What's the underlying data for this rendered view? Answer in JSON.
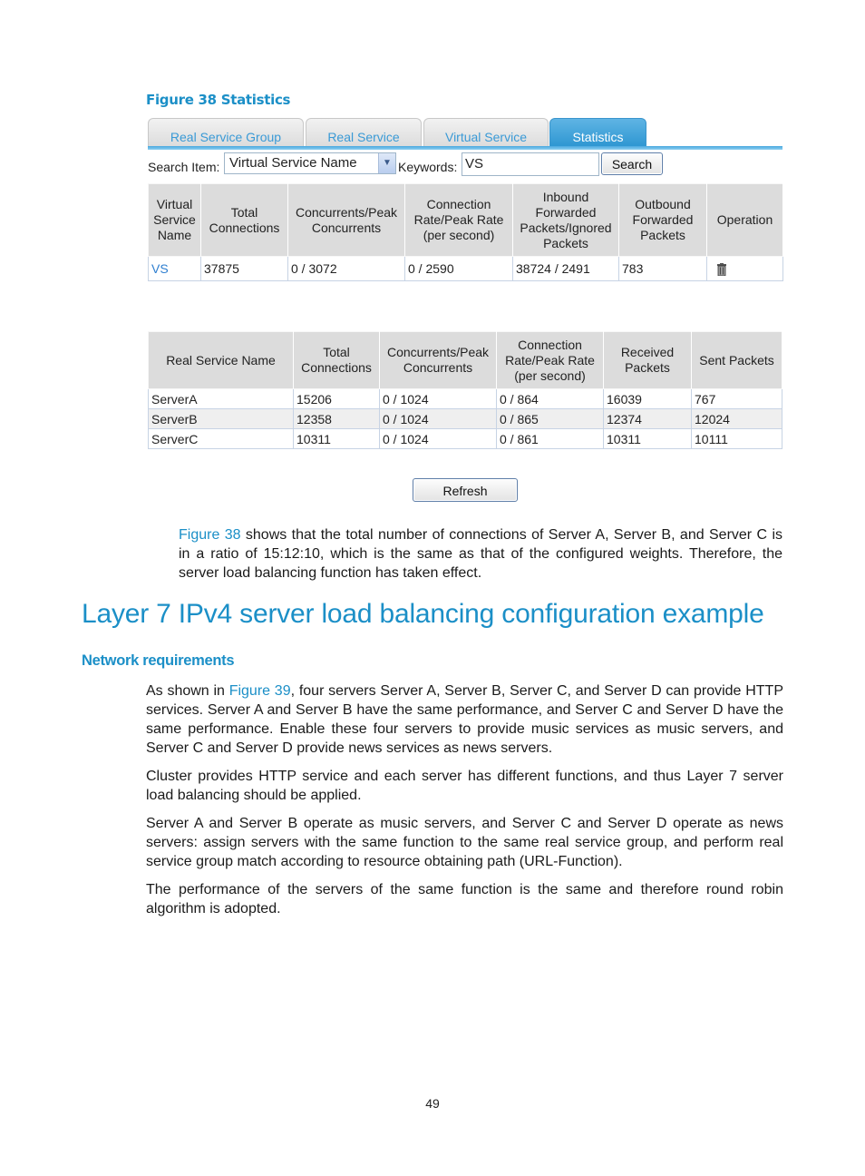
{
  "figure": {
    "caption": "Figure 38 Statistics",
    "tabs": [
      {
        "label": "Real Service Group",
        "active": false
      },
      {
        "label": "Real Service",
        "active": false
      },
      {
        "label": "Virtual Service",
        "active": false
      },
      {
        "label": "Statistics",
        "active": true
      }
    ],
    "search": {
      "item_label": "Search Item:",
      "item_value": "Virtual Service Name",
      "keywords_label": "Keywords:",
      "keywords_value": "VS",
      "search_button": "Search"
    },
    "virtual_table": {
      "headers": [
        "Virtual Service Name",
        "Total Connections",
        "Concurrents/Peak Concurrents",
        "Connection Rate/Peak Rate (per second)",
        "Inbound Forwarded Packets/Ignored Packets",
        "Outbound Forwarded Packets",
        "Operation"
      ],
      "rows": [
        {
          "name": "VS",
          "total": "37875",
          "concurrents": "0 / 3072",
          "rate": "0 / 2590",
          "inbound": "38724 / 2491",
          "outbound": "783",
          "operation_icon": "trash-icon"
        }
      ]
    },
    "real_table": {
      "headers": [
        "Real Service Name",
        "Total Connections",
        "Concurrents/Peak Concurrents",
        "Connection Rate/Peak Rate (per second)",
        "Received Packets",
        "Sent Packets"
      ],
      "rows": [
        {
          "name": "ServerA",
          "total": "15206",
          "concurrents": "0 / 1024",
          "rate": "0 / 864",
          "received": "16039",
          "sent": "767"
        },
        {
          "name": "ServerB",
          "total": "12358",
          "concurrents": "0 / 1024",
          "rate": "0 / 865",
          "received": "12374",
          "sent": "12024"
        },
        {
          "name": "ServerC",
          "total": "10311",
          "concurrents": "0 / 1024",
          "rate": "0 / 861",
          "received": "10311",
          "sent": "10111"
        }
      ]
    },
    "refresh_button": "Refresh"
  },
  "text": {
    "fig_para_ref": "Figure 38",
    "fig_para_rest": " shows that the total number of connections of Server A, Server B, and Server C is in a ratio of 15:12:10, which is the same as that of the configured weights. Therefore, the server load balancing function has taken effect.",
    "heading1": "Layer 7 IPv4 server load balancing configuration example",
    "heading2": "Network requirements",
    "p1_pre": "As shown in ",
    "p1_ref": "Figure 39",
    "p1_rest": ", four servers Server A, Server B, Server C, and Server D can provide HTTP services. Server A and Server B have the same performance, and Server C and Server D have the same performance. Enable these four servers to provide music services as music servers, and Server C and Server D provide news services as news servers.",
    "p2": "Cluster provides HTTP service and each server has different functions, and thus Layer 7 server load balancing should be applied.",
    "p3": "Server A and Server B operate as music servers, and Server C and Server D operate as news servers: assign servers with the same function to the same real service group, and perform real service group match according to resource obtaining path (URL-Function).",
    "p4": "The performance of the servers of the same function is the same and therefore round robin algorithm is adopted."
  },
  "page_number": "49"
}
